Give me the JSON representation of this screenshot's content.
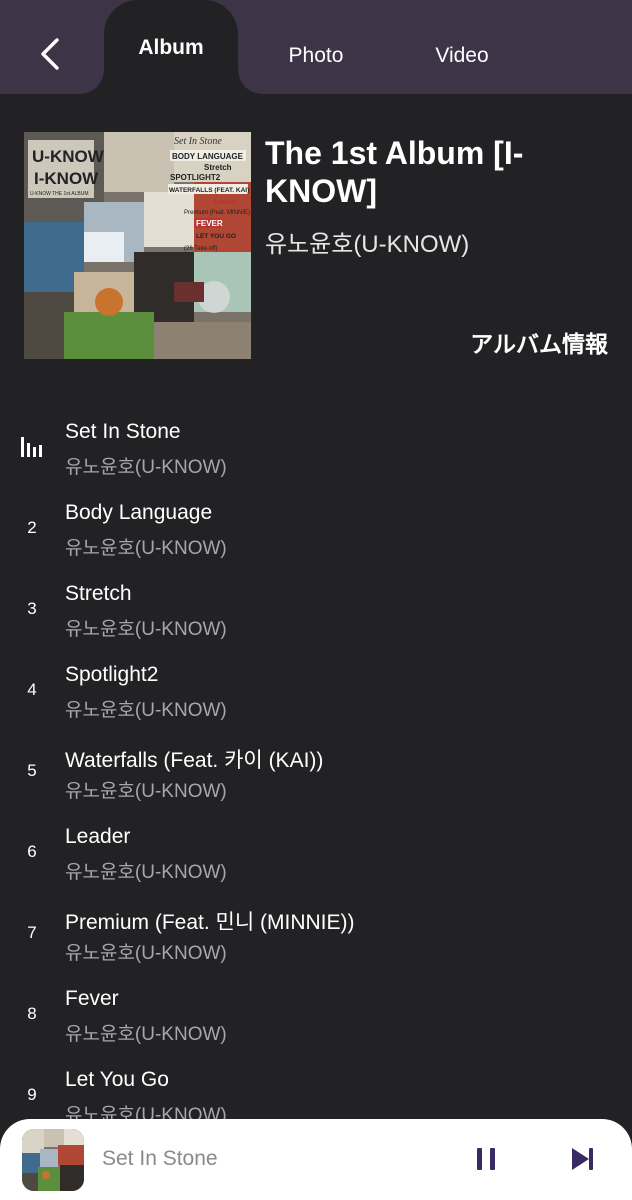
{
  "header": {
    "tabs": [
      {
        "label": "Album",
        "active": true
      },
      {
        "label": "Photo",
        "active": false
      },
      {
        "label": "Video",
        "active": false
      }
    ],
    "background_color": "#3d3448"
  },
  "album": {
    "title": "The 1st Album [I-KNOW]",
    "artist": "유노윤호(U-KNOW)",
    "info_button": "アルバム情報",
    "cover_art_text": {
      "logo_top": "U-KNOW",
      "logo_bottom": "I-KNOW",
      "logo_sub": "U-KNOW THE 1st ALBUM",
      "tracks_shown": [
        "Set In Stone",
        "BODY LANGUAGE",
        "Stretch",
        "SPOTLIGHT2",
        "WATERFALLS (FEAT. KAI)",
        "Leader",
        "Premium (Feat. MINNIE)",
        "FEVER",
        "LET YOU GO",
        "(26 Take-off)"
      ]
    }
  },
  "tracks": [
    {
      "number": "1",
      "title": "Set In Stone",
      "artist": "유노윤호(U-KNOW)",
      "playing": true
    },
    {
      "number": "2",
      "title": "Body Language",
      "artist": "유노윤호(U-KNOW)",
      "playing": false
    },
    {
      "number": "3",
      "title": "Stretch",
      "artist": "유노윤호(U-KNOW)",
      "playing": false
    },
    {
      "number": "4",
      "title": "Spotlight2",
      "artist": "유노윤호(U-KNOW)",
      "playing": false
    },
    {
      "number": "5",
      "title": "Waterfalls (Feat. 카이 (KAI))",
      "artist": "유노윤호(U-KNOW)",
      "playing": false
    },
    {
      "number": "6",
      "title": "Leader",
      "artist": "유노윤호(U-KNOW)",
      "playing": false
    },
    {
      "number": "7",
      "title": "Premium (Feat. 민니 (MINNIE))",
      "artist": "유노윤호(U-KNOW)",
      "playing": false
    },
    {
      "number": "8",
      "title": "Fever",
      "artist": "유노윤호(U-KNOW)",
      "playing": false
    },
    {
      "number": "9",
      "title": "Let You Go",
      "artist": "유노윤호(U-KNOW)",
      "playing": false
    }
  ],
  "player": {
    "now_playing": "Set In Stone",
    "state": "playing",
    "accent_color": "#3a2a63"
  },
  "icons": {
    "back": "chevron-left-icon",
    "now_playing": "equalizer-bars-icon",
    "pause": "pause-icon",
    "next": "skip-next-icon"
  }
}
